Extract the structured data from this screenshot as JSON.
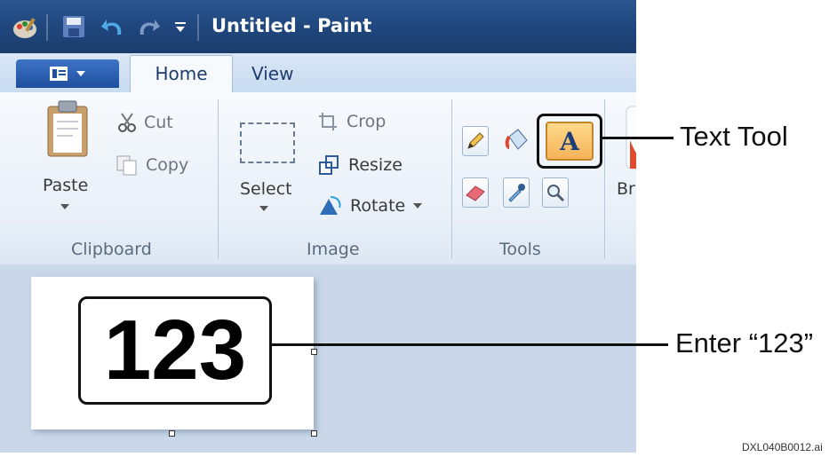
{
  "window": {
    "title": "Untitled - Paint",
    "colors": {
      "titlebar": "#1f467c",
      "ribbon": "#eef3f9",
      "canvas_area": "#c9d7e9",
      "text_tool_highlight": "#f5b35a"
    }
  },
  "quick_access": {
    "icons": [
      "paint-app-icon",
      "save-icon",
      "undo-icon",
      "redo-icon",
      "customize-dropdown-icon"
    ]
  },
  "tabs": {
    "menu_button_icon": "paint-menu-icon",
    "home": "Home",
    "view": "View"
  },
  "ribbon": {
    "clipboard": {
      "paste": "Paste",
      "cut": "Cut",
      "copy": "Copy",
      "group_label": "Clipboard"
    },
    "image": {
      "select": "Select",
      "crop": "Crop",
      "resize": "Resize",
      "rotate": "Rotate",
      "group_label": "Image"
    },
    "tools": {
      "group_label": "Tools",
      "items": [
        "pencil-icon",
        "fill-icon",
        "text-tool-icon",
        "eraser-icon",
        "color-picker-icon",
        "magnifier-icon"
      ],
      "text_tool_glyph": "A"
    },
    "brushes": {
      "label_partial": "Bru"
    }
  },
  "canvas": {
    "text": "123"
  },
  "callouts": {
    "text_tool": "Text Tool",
    "enter_text": "Enter “123”"
  },
  "footer": {
    "file_code": "DXL040B0012.ai"
  }
}
